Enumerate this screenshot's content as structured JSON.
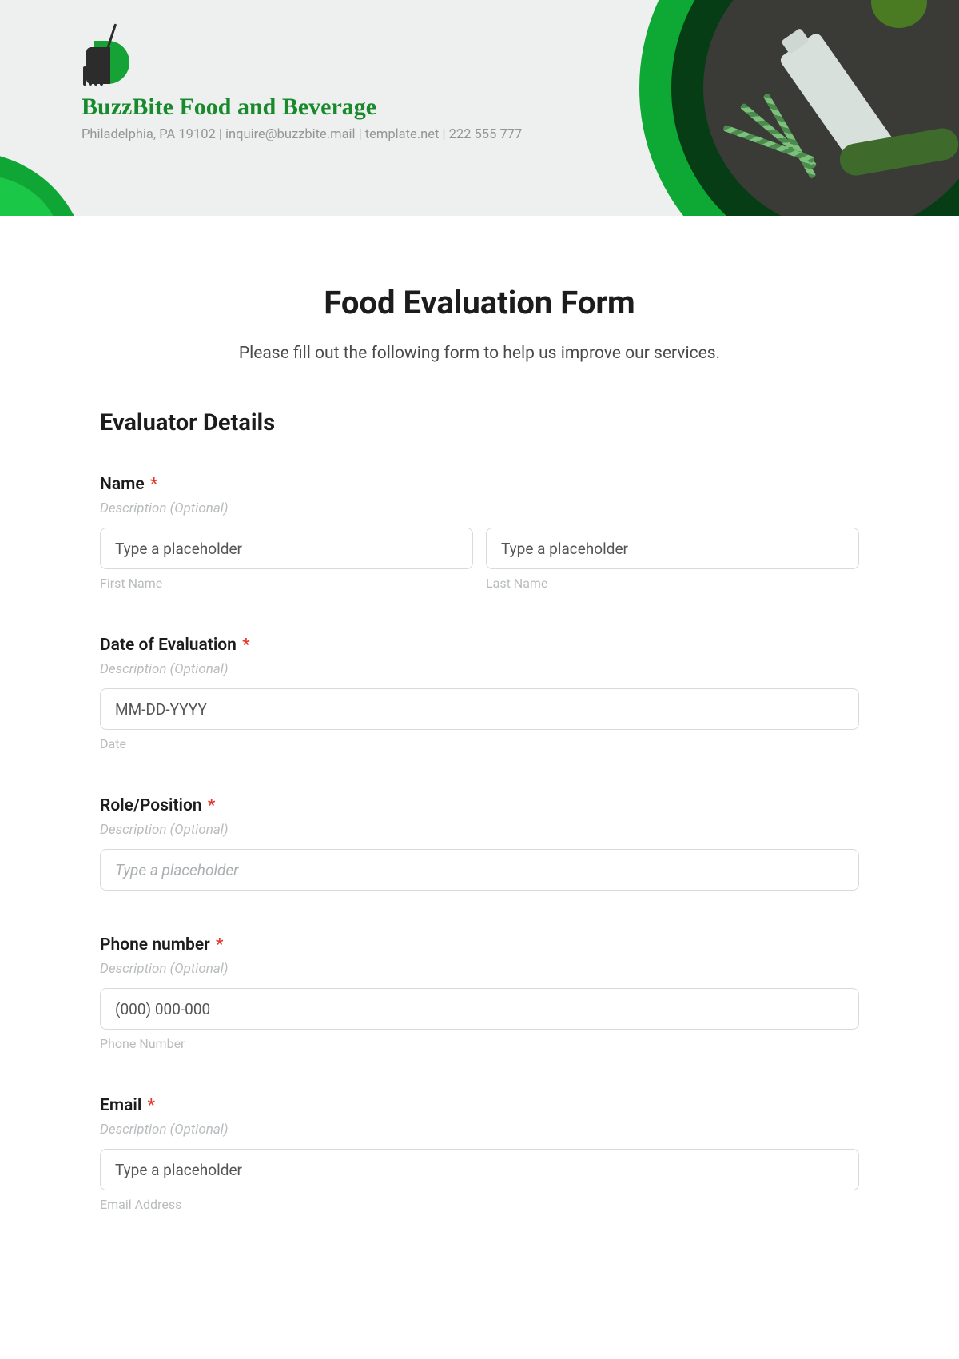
{
  "header": {
    "brand_name": "BuzzBite Food and Beverage",
    "brand_sub": "Philadelphia, PA 19102 | inquire@buzzbite.mail | template.net | 222 555 777"
  },
  "form": {
    "title": "Food Evaluation Form",
    "subtitle": "Please fill out the following form to help us improve our services.",
    "section1_title": "Evaluator Details",
    "desc_text": "Description (Optional)",
    "fields": {
      "name": {
        "label": "Name",
        "first_placeholder": "Type a placeholder",
        "last_placeholder": "Type a placeholder",
        "first_sub": "First Name",
        "last_sub": "Last Name"
      },
      "date": {
        "label": "Date of Evaluation",
        "placeholder": "MM-DD-YYYY",
        "sub": "Date"
      },
      "role": {
        "label": "Role/Position",
        "placeholder": "Type a placeholder"
      },
      "phone": {
        "label": "Phone number",
        "placeholder": "(000) 000-000",
        "sub": "Phone Number"
      },
      "email": {
        "label": "Email",
        "placeholder": "Type a placeholder",
        "sub": "Email Address"
      }
    },
    "required_marker": "*"
  }
}
